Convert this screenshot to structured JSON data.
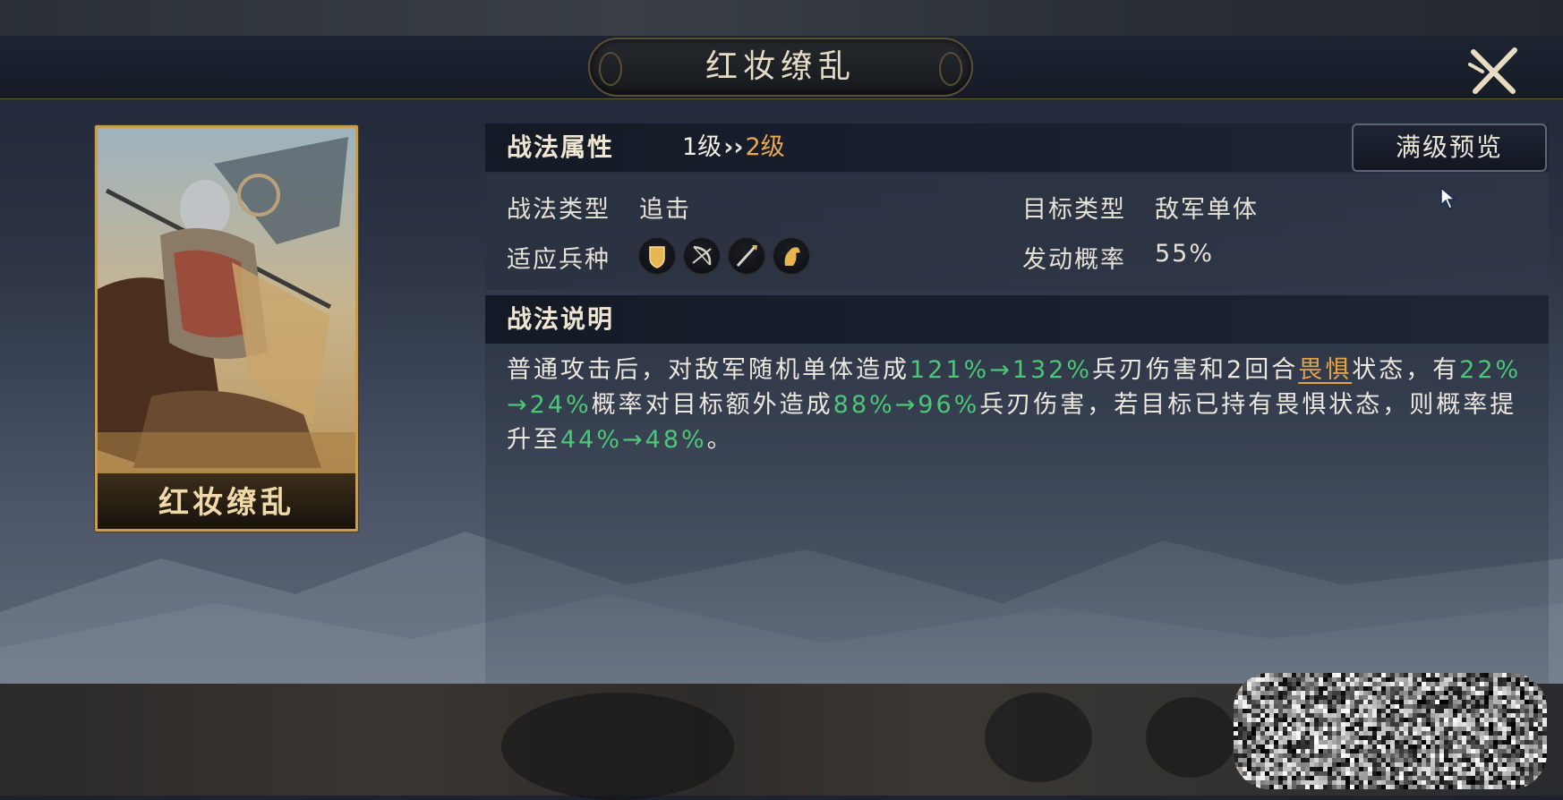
{
  "header": {
    "title": "红妆缭乱"
  },
  "card": {
    "name": "红妆缭乱"
  },
  "attributes": {
    "section_label": "战法属性",
    "level_from": "1级",
    "level_arrow": "››",
    "level_to": "2级",
    "max_preview_button": "满级预览",
    "type_label": "战法类型",
    "type_value": "追击",
    "target_label": "目标类型",
    "target_value": "敌军单体",
    "troops_label": "适应兵种",
    "troop_icons": [
      "shield-icon",
      "bow-icon",
      "spear-icon",
      "horse-icon"
    ],
    "chance_label": "发动概率",
    "chance_value": "55%"
  },
  "description": {
    "section_label": "战法说明",
    "parts": [
      {
        "text": "普通攻击后，对敌军随机单体造成",
        "style": "normal"
      },
      {
        "text": "121%→132%",
        "style": "green"
      },
      {
        "text": "兵刃伤害和2回合",
        "style": "normal"
      },
      {
        "text": "畏惧",
        "style": "orange"
      },
      {
        "text": "状态，有",
        "style": "normal"
      },
      {
        "text": "22%→24%",
        "style": "green"
      },
      {
        "text": "概率对目标额外造成",
        "style": "normal"
      },
      {
        "text": "88%→96%",
        "style": "green"
      },
      {
        "text": "兵刃伤害，若目标已持有畏惧状态，则概率提升至",
        "style": "normal"
      },
      {
        "text": "44%→48%",
        "style": "green"
      },
      {
        "text": "。",
        "style": "normal"
      }
    ]
  },
  "colors": {
    "accent_gold": "#c99c4e",
    "level_orange": "#e7a951",
    "value_green": "#4cc777",
    "status_orange": "#e6a24a"
  }
}
